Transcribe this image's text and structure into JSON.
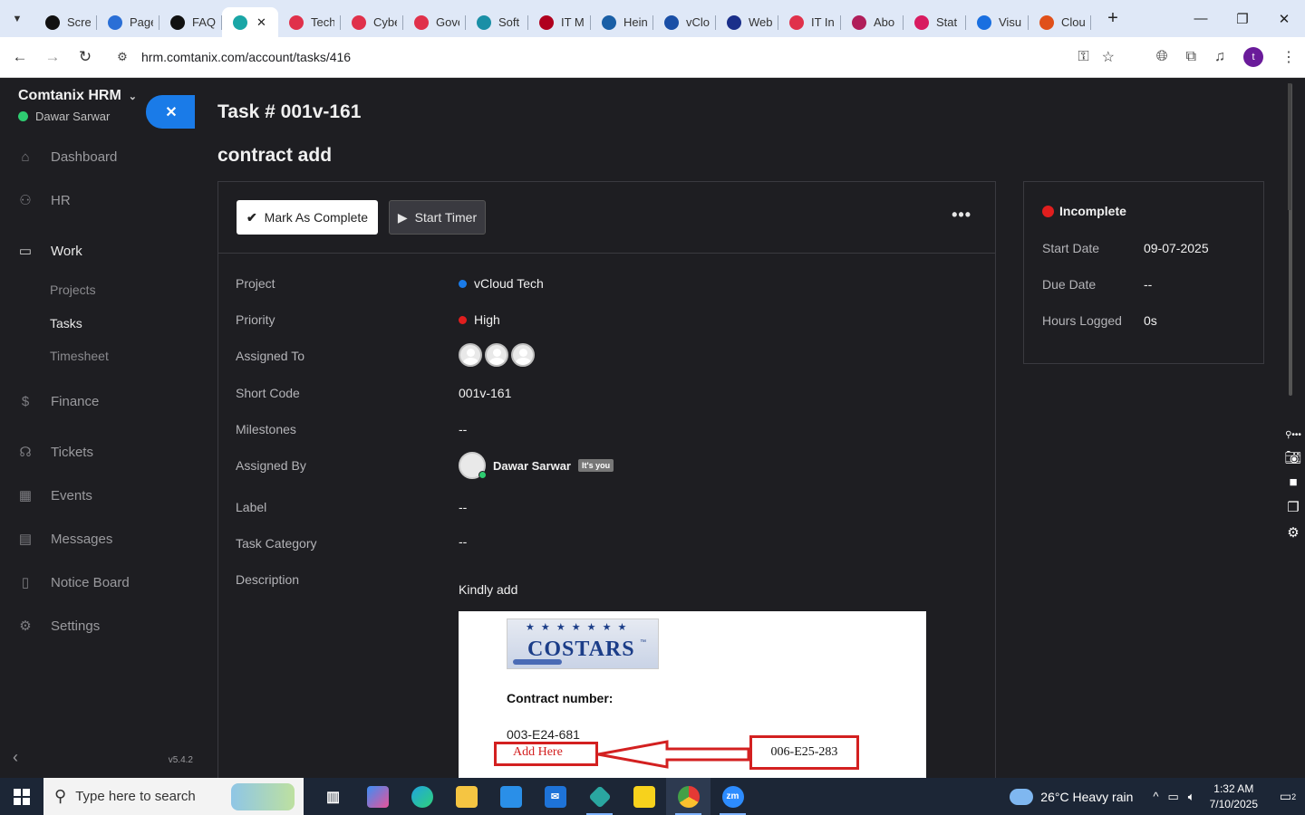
{
  "browser": {
    "tabs": [
      {
        "label": "Scre",
        "icon": "github-icon",
        "color": "#111111"
      },
      {
        "label": "Page",
        "icon": "gauge-icon",
        "color": "#2a6fd6"
      },
      {
        "label": "FAQ",
        "icon": "github-icon",
        "color": "#111111"
      },
      {
        "label": "",
        "icon": "vcloud-icon",
        "color": "#1aa6a6",
        "active": true
      },
      {
        "label": "Tech",
        "icon": "diamond-icon",
        "color": "#e0314b"
      },
      {
        "label": "Cybe",
        "icon": "diamond-icon",
        "color": "#e0314b"
      },
      {
        "label": "Gove",
        "icon": "diamond-icon",
        "color": "#e0314b"
      },
      {
        "label": "Soft",
        "icon": "hex-icon",
        "color": "#1a8fa6"
      },
      {
        "label": "IT M",
        "icon": "v-logo-icon",
        "color": "#b0001e"
      },
      {
        "label": "Hein",
        "icon": "scale-icon",
        "color": "#1a5fa6"
      },
      {
        "label": "vClo",
        "icon": "check-logo-icon",
        "color": "#1a4fa6"
      },
      {
        "label": "Web",
        "icon": "x-logo-icon",
        "color": "#1a2f8a"
      },
      {
        "label": "IT In",
        "icon": "diamond-icon",
        "color": "#e0314b"
      },
      {
        "label": "Abo",
        "icon": "sphere-icon",
        "color": "#b01e5a"
      },
      {
        "label": "Stat",
        "icon": "pen-icon",
        "color": "#d81b60"
      },
      {
        "label": "Visu",
        "icon": "pulse-icon",
        "color": "#1a6fe0"
      },
      {
        "label": "Clou",
        "icon": "slash-icon",
        "color": "#e0501a"
      }
    ],
    "url": "hrm.comtanix.com/account/tasks/416",
    "profile_initial": "t"
  },
  "sidebar": {
    "brand": "Comtanix HRM",
    "user": "Dawar Sarwar",
    "items": [
      {
        "label": "Dashboard",
        "icon": "home-icon"
      },
      {
        "label": "HR",
        "icon": "users-icon"
      },
      {
        "label": "Work",
        "icon": "briefcase-icon"
      },
      {
        "label": "Finance",
        "icon": "dollar-icon"
      },
      {
        "label": "Tickets",
        "icon": "headset-icon"
      },
      {
        "label": "Events",
        "icon": "calendar-icon"
      },
      {
        "label": "Messages",
        "icon": "message-icon"
      },
      {
        "label": "Notice Board",
        "icon": "clipboard-icon"
      },
      {
        "label": "Settings",
        "icon": "gear-icon"
      }
    ],
    "subitems": [
      "Projects",
      "Tasks",
      "Timesheet"
    ],
    "version": "v5.4.2"
  },
  "task": {
    "number": "Task # 001v-161",
    "title": "contract add",
    "mark_complete": "Mark As Complete",
    "start_timer": "Start Timer",
    "labels": {
      "project": "Project",
      "priority": "Priority",
      "assigned_to": "Assigned To",
      "short_code": "Short Code",
      "milestones": "Milestones",
      "assigned_by": "Assigned By",
      "label": "Label",
      "task_category": "Task Category",
      "description": "Description"
    },
    "values": {
      "project": "vCloud Tech",
      "priority": "High",
      "short_code": "001v-161",
      "milestones": "--",
      "assigned_by": "Dawar Sarwar",
      "its_you": "It's you",
      "label": "--",
      "task_category": "--",
      "description": "Kindly add"
    },
    "colors": {
      "project_dot": "#1a7be8",
      "priority_dot": "#e01e1e"
    },
    "attachment": {
      "logo_text": "COSTARS",
      "contract_label": "Contract number:",
      "contract_number": "003-E24-681",
      "add_here": "Add Here",
      "new_number": "006-E25-283"
    }
  },
  "status": {
    "title": "Incomplete",
    "start_date_label": "Start Date",
    "start_date": "09-07-2025",
    "due_date_label": "Due Date",
    "due_date": "--",
    "hours_label": "Hours Logged",
    "hours": "0s"
  },
  "taskbar": {
    "search_placeholder": "Type here to search",
    "weather": "26°C  Heavy rain",
    "time": "1:32 AM",
    "date": "7/10/2025",
    "notifications": "2"
  }
}
